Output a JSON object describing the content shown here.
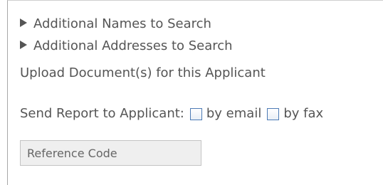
{
  "search_options": {
    "additional_names": "Additional Names to Search",
    "additional_addresses": "Additional Addresses to Search"
  },
  "upload": {
    "label": "Upload Document(s) for this Applicant"
  },
  "send_report": {
    "label": "Send Report to Applicant:",
    "email_label": "by email",
    "fax_label": "by fax",
    "email_checked": false,
    "fax_checked": false
  },
  "reference_code": {
    "placeholder": "Reference Code",
    "value": ""
  },
  "colors": {
    "text": "#555555",
    "checkbox_border": "#4d7bb5",
    "input_background": "#efefef"
  }
}
